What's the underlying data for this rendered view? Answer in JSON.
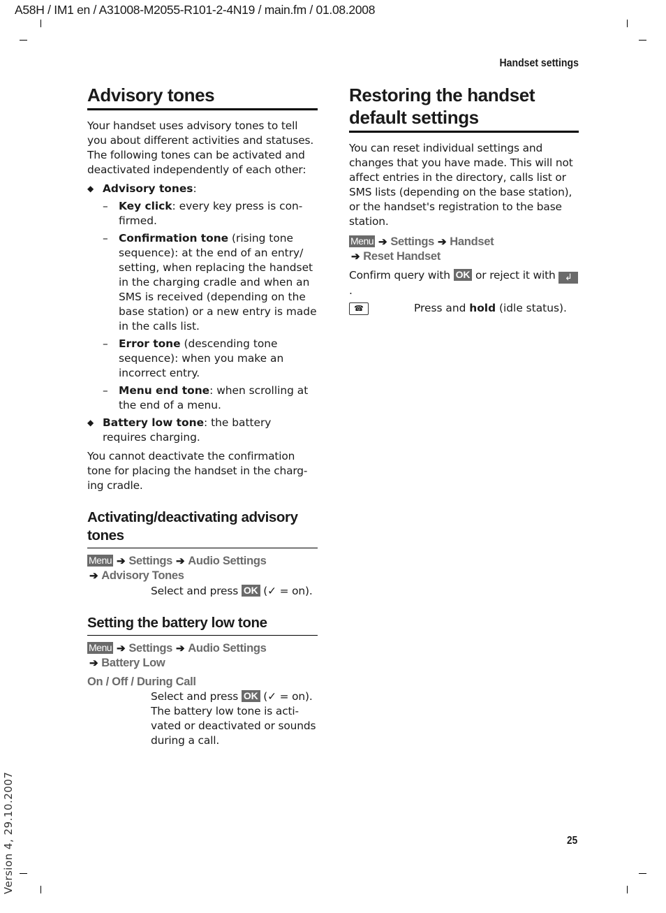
{
  "header": {
    "doc_path": "A58H / IM1 en / A31008-M2055-R101-2-4N19 / main.fm / 01.08.2008",
    "running_title": "Handset settings"
  },
  "footer": {
    "version": "Version 4, 29.10.2007",
    "page_number": "25"
  },
  "left": {
    "title": "Advisory tones",
    "intro": "Your handset uses advisory tones to tell you about different activities and statuses. The following tones can be activated and deactivated independently of each other:",
    "bullets": [
      {
        "term": "Advisory tones",
        "text": ":",
        "sub": [
          {
            "term": "Key click",
            "text": ": every key press is con-firmed."
          },
          {
            "term": "Confirmation tone",
            "text": " (rising tone sequence): at the end of an entry/ setting, when replacing the handset in the charging cradle and when an SMS is received (depending on the base station) or a new entry is made in the calls list."
          },
          {
            "term": "Error tone",
            "text": " (descending tone sequence): when you make an incorrect entry."
          },
          {
            "term": "Menu end tone",
            "text": ": when scrolling at the end of a menu."
          }
        ]
      },
      {
        "term": "Battery low tone",
        "text": ": the battery requires charging."
      }
    ],
    "note": "You cannot deactivate the confirmation tone for placing the handset in the charg-ing cradle.",
    "section_activate": {
      "title": "Activating/deactivating advisory tones",
      "menu_badge": "Menu",
      "path": [
        "Settings",
        "Audio Settings",
        "Advisory Tones"
      ],
      "instruction_pre": "Select and press",
      "ok_label": "OK",
      "instruction_post": "(✓ = on)."
    },
    "section_battery": {
      "title": "Setting the battery low tone",
      "menu_badge": "Menu",
      "path": [
        "Settings",
        "Audio Settings",
        "Battery Low"
      ],
      "options": "On / Off / During Call",
      "instruction_pre": "Select and press",
      "ok_label": "OK",
      "instruction_post": "(✓ = on).",
      "description": "The battery low tone is acti-vated or deactivated or sounds during a call."
    }
  },
  "right": {
    "title": "Restoring the handset default settings",
    "intro": "You can reset individual settings and changes that you have made. This will not affect entries in the directory, calls list or SMS lists (depending on the base station), or the handset's registration to the base station.",
    "menu_badge": "Menu",
    "path": [
      "Settings",
      "Handset",
      "Reset Handset"
    ],
    "confirm_pre": "Confirm query with",
    "ok_label": "OK",
    "confirm_mid": "or reject it with",
    "confirm_post": ".",
    "back_icon": "back-arrow-icon",
    "end_key_icon": "end-call-key-icon",
    "end_key_text_pre": "Press and",
    "end_key_bold": "hold",
    "end_key_text_post": "(idle status)."
  }
}
